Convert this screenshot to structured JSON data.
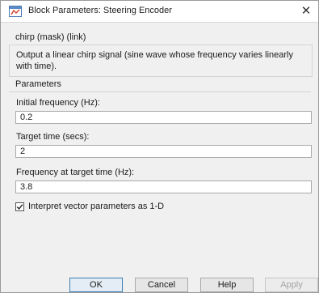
{
  "window": {
    "title": "Block Parameters: Steering Encoder",
    "close_glyph": "✕"
  },
  "block": {
    "subtitle": "chirp (mask) (link)",
    "description": "Output a linear chirp signal (sine wave  whose frequency varies linearly with time)."
  },
  "parameters": {
    "heading": "Parameters",
    "initial_frequency": {
      "label": "Initial frequency (Hz):",
      "value": "0.2"
    },
    "target_time": {
      "label": "Target time (secs):",
      "value": "2"
    },
    "frequency_at_target": {
      "label": "Frequency at target time (Hz):",
      "value": "3.8"
    },
    "interpret_vector": {
      "label": "Interpret vector parameters as 1-D",
      "checked": true
    }
  },
  "buttons": {
    "ok": "OK",
    "cancel": "Cancel",
    "help": "Help",
    "apply": "Apply"
  },
  "icons": {
    "window_icon": "simulink-block-icon",
    "close": "close-icon",
    "checkbox": "checkmark-icon"
  },
  "colors": {
    "dialog_background": "#f0f0f0",
    "default_button_border": "#3c7fb1",
    "disabled_text": "#a3a3a3"
  }
}
